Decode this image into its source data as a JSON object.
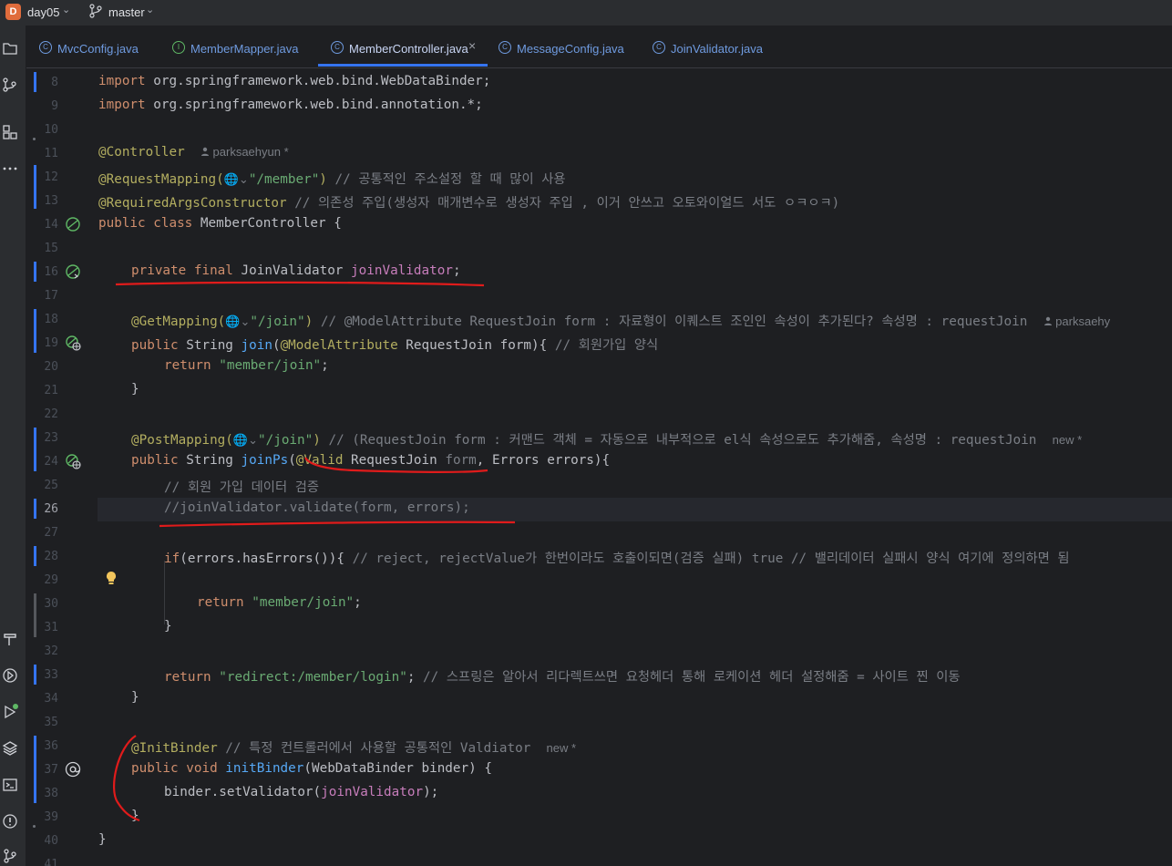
{
  "titlebar": {
    "project_badge": "D",
    "project_name": "day05",
    "branch": "master"
  },
  "tabs": [
    {
      "label": "MvcConfig.java"
    },
    {
      "label": "MemberMapper.java"
    },
    {
      "label": "MemberController.java",
      "active": true
    },
    {
      "label": "MessageConfig.java"
    },
    {
      "label": "JoinValidator.java"
    }
  ],
  "gutter": {
    "line_numbers": [
      "8",
      "9",
      "10",
      "11",
      "12",
      "13",
      "14",
      "15",
      "16",
      "17",
      "18",
      "19",
      "20",
      "21",
      "22",
      "23",
      "24",
      "25",
      "26",
      "27",
      "28",
      "29",
      "30",
      "31",
      "32",
      "33",
      "34",
      "35",
      "36",
      "37",
      "38",
      "39",
      "40",
      "41"
    ],
    "current_line": "26"
  },
  "code": {
    "l8": {
      "kw": "import",
      "rest": " org.springframework.web.bind.WebDataBinder;"
    },
    "l9": {
      "kw": "import",
      "rest": " org.springframework.web.bind.annotation.*;"
    },
    "l11": {
      "ann": "@Controller",
      "author": "parksaehyun *"
    },
    "l12": {
      "ann": "@RequestMapping(",
      "str": "\"/member\"",
      "close": ")",
      "comment": " // 공통적인 주소설정 할 때 많이 사용"
    },
    "l13": {
      "ann": "@RequiredArgsConstructor",
      "comment": " // 의존성 주입(생성자 매개변수로 생성자 주입 , 이거 안쓰고 오토와이얼드 서도 ㅇㅋㅇㅋ)"
    },
    "l14": {
      "kw": "public class",
      "rest": " MemberController {"
    },
    "l16": {
      "kw": "private final",
      "type": " JoinValidator ",
      "field": "joinValidator",
      "end": ";"
    },
    "l18": {
      "ann": "@GetMapping(",
      "str": "\"/join\"",
      "close": ")",
      "comment": " // @ModelAttribute RequestJoin form : 자료형이 이퀘스트 조인인 속성이 추가된다? 속성명 : requestJoin",
      "author": "parksaehy"
    },
    "l19": {
      "kw": "public",
      "type": " String ",
      "fn": "join",
      "open": "(",
      "ann": "@ModelAttribute",
      "rest": " RequestJoin form){",
      "comment": " // 회원가입 양식"
    },
    "l20": {
      "kw": "return",
      "str": " \"member/join\"",
      "end": ";"
    },
    "l21": {
      "text": "}"
    },
    "l23": {
      "ann": "@PostMapping(",
      "str": "\"/join\"",
      "close": ")",
      "comment": " // (RequestJoin form : 커맨드 객체 = 자동으로 내부적으로 el식 속성으로도 추가해줌, 속성명 : requestJoin",
      "hint": "new *"
    },
    "l24": {
      "kw": "public",
      "type": " String ",
      "fn": "joinPs",
      "open": "(",
      "ann": "@Valid",
      "rest": " RequestJoin ",
      "param": "form",
      "rest2": ", Errors errors){"
    },
    "l25": {
      "comment": "// 회원 가입 데이터 검증"
    },
    "l26": {
      "comment": "//joinValidator.validate(form, errors);"
    },
    "l28": {
      "kw": "if",
      "rest": "(errors.hasErrors()){",
      "comment": " // reject, rejectValue가 한번이라도 호출이되면(검증 실패) true // 밸리데이터 실패시 양식 여기에 정의하면 됨"
    },
    "l30": {
      "kw": "return",
      "str": " \"member/join\"",
      "end": ";"
    },
    "l31": {
      "text": "}"
    },
    "l33": {
      "kw": "return",
      "str": " \"redirect:/member/login\"",
      "end": ";",
      "comment": " // 스프링은 알아서 리다렉트쓰면 요청헤더 통해 로케이션 헤더 설정해줌 = 사이트 찐 이동"
    },
    "l34": {
      "text": "}"
    },
    "l36": {
      "ann": "@InitBinder",
      "comment": " // 특정 컨트롤러에서 사용할 공통적인 Valdiator",
      "hint": "new *"
    },
    "l37": {
      "kw": "public void",
      "fn": " initBinder",
      "rest": "(WebDataBinder binder) {"
    },
    "l38": {
      "pre": "binder.setValidator(",
      "field": "joinValidator",
      "end": ");"
    },
    "l39": {
      "text": "}"
    },
    "l40": {
      "text": "}"
    }
  },
  "colors": {
    "background": "#1e1f22",
    "keyword": "#cf8e6d",
    "annotation": "#b3ae60",
    "string": "#6aab73",
    "comment": "#7a7e85",
    "function": "#56a8f5",
    "field": "#c77dbb",
    "red_marker": "#e01b1b"
  }
}
